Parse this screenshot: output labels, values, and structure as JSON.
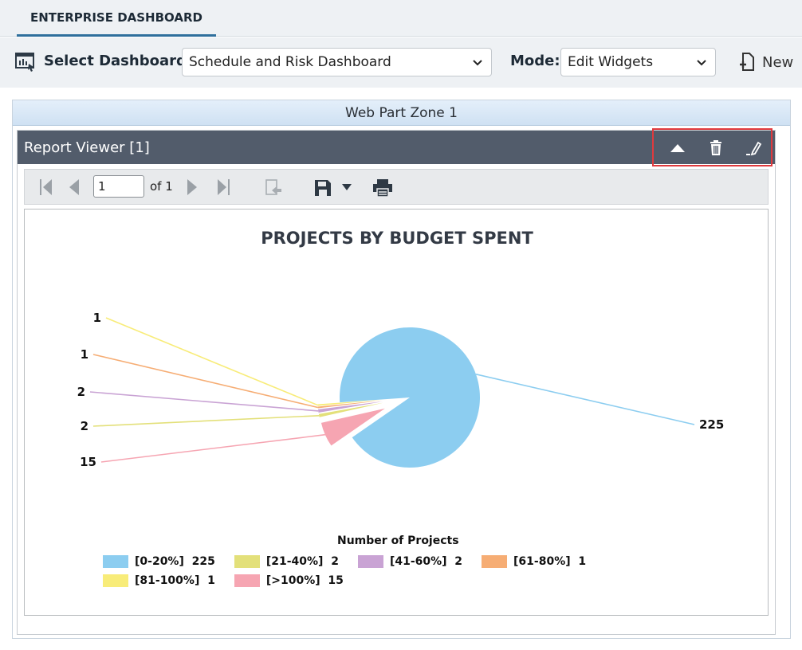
{
  "tabs": [
    {
      "label": "ENTERPRISE DASHBOARD"
    }
  ],
  "toolbar": {
    "select_dashboard_label": "Select Dashboard:",
    "dashboard_value": "Schedule and Risk Dashboard",
    "mode_label": "Mode:",
    "mode_value": "Edit Widgets",
    "new_label": "New"
  },
  "zone": {
    "title": "Web Part Zone 1"
  },
  "viewer": {
    "title": "Report Viewer [1]",
    "page_value": "1",
    "page_of": "of 1"
  },
  "chart_data": {
    "type": "pie",
    "title": "PROJECTS BY BUDGET SPENT",
    "legend_title": "Number of Projects",
    "categories": [
      "[0-20%]",
      "[21-40%]",
      "[41-60%]",
      "[61-80%]",
      "[81-100%]",
      "[>100%]"
    ],
    "values": [
      225,
      2,
      2,
      1,
      1,
      15
    ],
    "colors": [
      "#8ccdf0",
      "#e3e07a",
      "#c9a3d4",
      "#f6ad74",
      "#f8ec79",
      "#f6a5b2"
    ],
    "exploded": [
      "[21-40%]",
      "[41-60%]",
      "[61-80%]",
      "[81-100%]",
      "[>100%]"
    ],
    "legend_position": "bottom"
  }
}
